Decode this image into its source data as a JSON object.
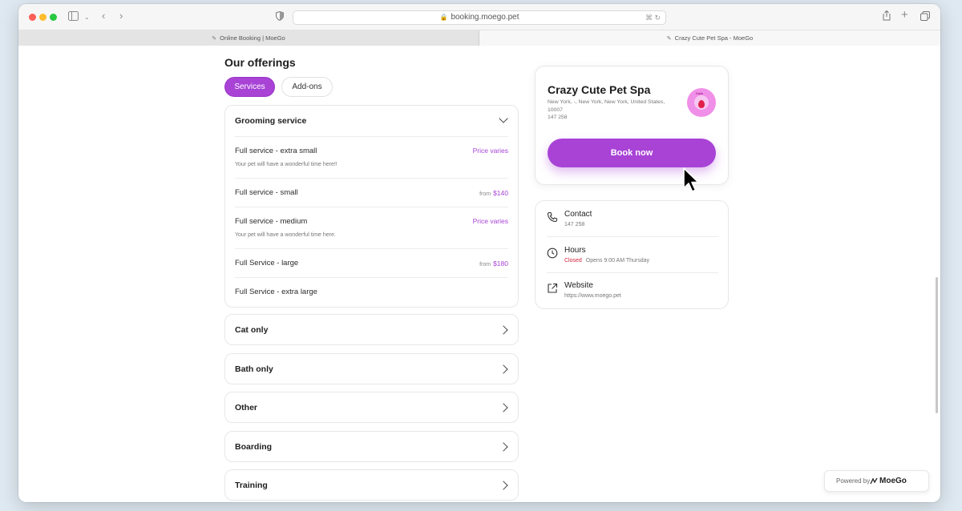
{
  "browser": {
    "url": "booking.moego.pet",
    "tabs": [
      {
        "label": "Online Booking | MoeGo"
      },
      {
        "label": "Crazy Cute Pet Spa - MoeGo"
      }
    ]
  },
  "offerings": {
    "title": "Our offerings",
    "pills": [
      {
        "label": "Services",
        "active": true
      },
      {
        "label": "Add-ons",
        "active": false
      }
    ],
    "grooming": {
      "title": "Grooming service",
      "services": [
        {
          "name": "Full service - extra small",
          "price": "Price varies",
          "from": "",
          "desc": "Your pet will have a wonderful time here!!"
        },
        {
          "name": "Full service - small",
          "price": "$140",
          "from": "from",
          "desc": ""
        },
        {
          "name": "Full service - medium",
          "price": "Price varies",
          "from": "",
          "desc": "Your pet will have a wonderful time here."
        },
        {
          "name": "Full Service - large",
          "price": "$180",
          "from": "from",
          "desc": ""
        },
        {
          "name": "Full Service - extra large",
          "price": "",
          "from": "",
          "desc": ""
        }
      ]
    },
    "categories": [
      "Cat only",
      "Bath only",
      "Other",
      "Boarding",
      "Training"
    ]
  },
  "business": {
    "name": "Crazy Cute Pet Spa",
    "address_line1": "New York, -, New York, New York, United States,",
    "address_line2": "10007",
    "phone": "147 258",
    "book_label": "Book now",
    "logo_text": "Cute"
  },
  "info": {
    "contact": {
      "title": "Contact",
      "value": "147 258"
    },
    "hours": {
      "title": "Hours",
      "status": "Closed",
      "detail": "Opens 9:00 AM Thursday"
    },
    "website": {
      "title": "Website",
      "value": "https://www.moego.pet"
    }
  },
  "powered": {
    "label": "Powered by",
    "brand": "MoeGo"
  },
  "colors": {
    "accent": "#a843d6",
    "closed": "#d4213d"
  }
}
